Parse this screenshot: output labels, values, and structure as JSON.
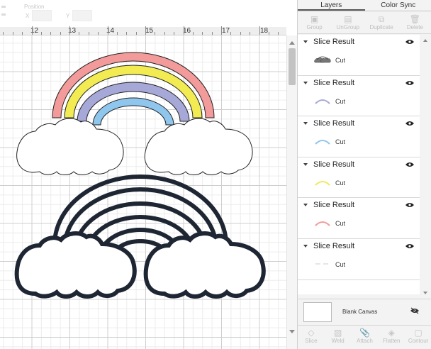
{
  "position": {
    "label": "Position",
    "x_label": "X",
    "y_label": "Y"
  },
  "ruler": {
    "numbers": [
      "12",
      "13",
      "14",
      "15",
      "16",
      "17",
      "18"
    ]
  },
  "panel": {
    "tabs": [
      {
        "label": "Layers",
        "active": true
      },
      {
        "label": "Color Sync",
        "active": false
      }
    ],
    "toolbar": [
      {
        "label": "Group",
        "icon": "group-icon"
      },
      {
        "label": "UnGroup",
        "icon": "ungroup-icon"
      },
      {
        "label": "Duplicate",
        "icon": "duplicate-icon"
      },
      {
        "label": "Delete",
        "icon": "delete-icon"
      }
    ],
    "layers": [
      {
        "name": "Slice Result",
        "op": "Cut",
        "thumb": "clouds",
        "color": "#555555"
      },
      {
        "name": "Slice Result",
        "op": "Cut",
        "thumb": "arc",
        "color": "#a6a8d8"
      },
      {
        "name": "Slice Result",
        "op": "Cut",
        "thumb": "arc",
        "color": "#8fc6ee"
      },
      {
        "name": "Slice Result",
        "op": "Cut",
        "thumb": "arc",
        "color": "#eeea5a"
      },
      {
        "name": "Slice Result",
        "op": "Cut",
        "thumb": "arc",
        "color": "#f39a9a"
      },
      {
        "name": "Slice Result",
        "op": "Cut",
        "thumb": "dots",
        "color": "#dddddd"
      }
    ],
    "blank_canvas": {
      "label": "Blank Canvas"
    },
    "bottom_tools": [
      {
        "label": "Slice",
        "icon": "slice-icon"
      },
      {
        "label": "Weld",
        "icon": "weld-icon"
      },
      {
        "label": "Attach",
        "icon": "attach-icon"
      },
      {
        "label": "Flatten",
        "icon": "flatten-icon"
      },
      {
        "label": "Contour",
        "icon": "contour-icon"
      }
    ]
  },
  "colors": {
    "pink": "#f39a9a",
    "yellow": "#f2ec52",
    "lavender": "#a6a8d8",
    "skyblue": "#8fc6ee",
    "navy": "#1f2633"
  }
}
